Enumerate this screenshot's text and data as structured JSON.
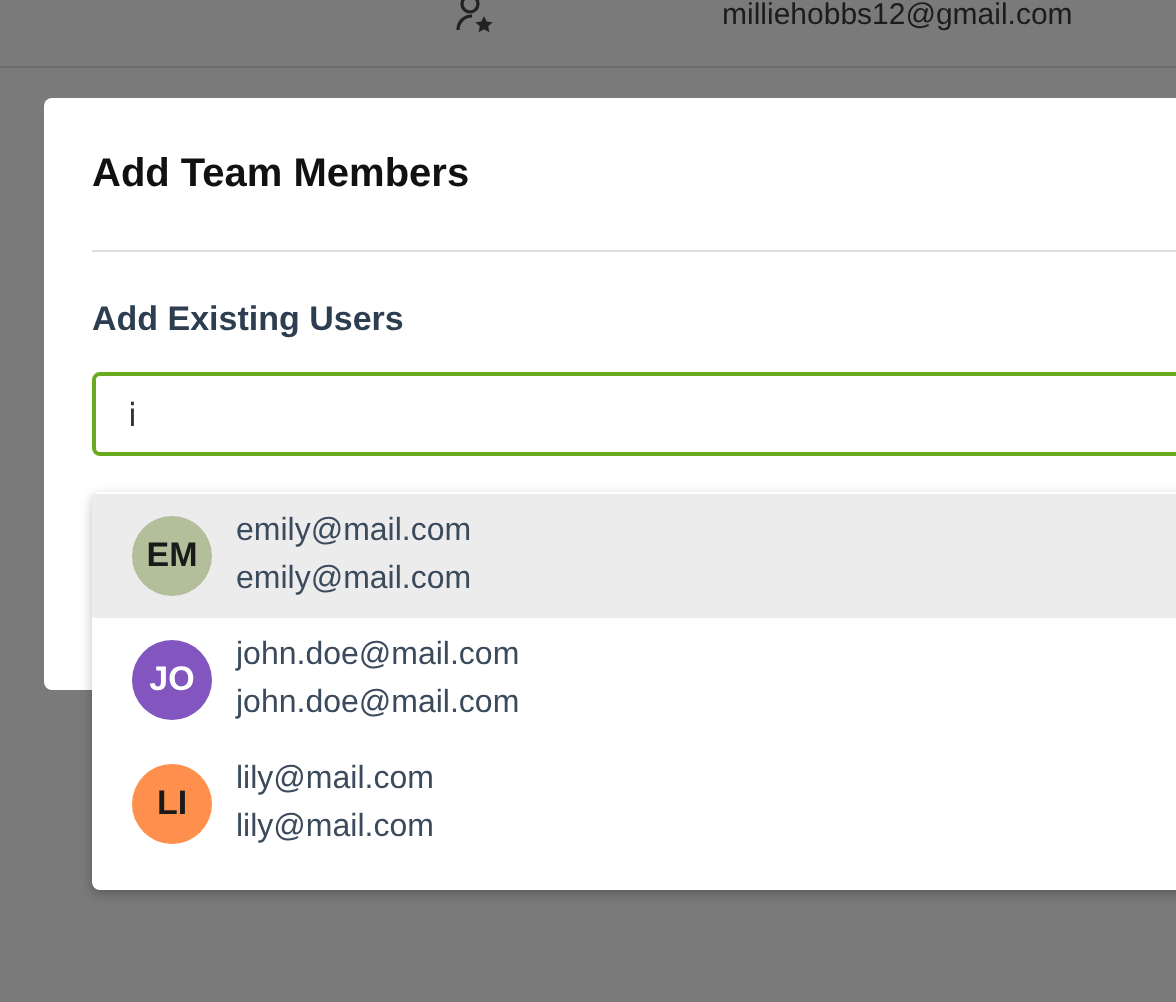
{
  "header": {
    "user_email": "milliehobbs12@gmail.com"
  },
  "dialog": {
    "title": "Add Team Members",
    "section_label": "Add Existing Users",
    "search": {
      "value": "i",
      "focused": true
    }
  },
  "suggestions": [
    {
      "initials": "EM",
      "color": "#b3bf9a",
      "primary": "emily@mail.com",
      "secondary": "emily@mail.com",
      "selected": true
    },
    {
      "initials": "JO",
      "color": "#8355bf",
      "primary": "john.doe@mail.com",
      "secondary": "john.doe@mail.com",
      "selected": false
    },
    {
      "initials": "LI",
      "color": "#ff8f4d",
      "primary": "lily@mail.com",
      "secondary": "lily@mail.com",
      "selected": false
    }
  ]
}
